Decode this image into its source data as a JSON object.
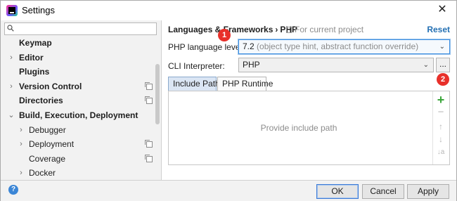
{
  "window": {
    "title": "Settings",
    "close_glyph": "✕"
  },
  "search": {
    "value": "",
    "placeholder": ""
  },
  "tree": [
    {
      "label": "Keymap",
      "bold": true,
      "level": 0,
      "expand": "",
      "copy": false
    },
    {
      "label": "Editor",
      "bold": true,
      "level": 0,
      "expand": "›",
      "copy": false
    },
    {
      "label": "Plugins",
      "bold": true,
      "level": 0,
      "expand": "",
      "copy": false
    },
    {
      "label": "Version Control",
      "bold": true,
      "level": 0,
      "expand": "›",
      "copy": true
    },
    {
      "label": "Directories",
      "bold": true,
      "level": 0,
      "expand": "",
      "copy": true
    },
    {
      "label": "Build, Execution, Deployment",
      "bold": true,
      "level": 0,
      "expand": "⌄",
      "copy": false
    },
    {
      "label": "Debugger",
      "bold": false,
      "level": 1,
      "expand": "›",
      "copy": false
    },
    {
      "label": "Deployment",
      "bold": false,
      "level": 1,
      "expand": "›",
      "copy": true
    },
    {
      "label": "Coverage",
      "bold": false,
      "level": 1,
      "expand": "",
      "copy": true
    },
    {
      "label": "Docker",
      "bold": false,
      "level": 1,
      "expand": "›",
      "copy": false
    }
  ],
  "header": {
    "crumb1": "Languages & Frameworks",
    "sep": "›",
    "crumb2": "PHP",
    "scope": "For current project",
    "reset": "Reset"
  },
  "form": {
    "language_level_label": "PHP language level:",
    "language_level_value": "7.2",
    "language_level_hint": "(object type hint, abstract function override)",
    "cli_label": "CLI Interpreter:",
    "cli_value": "PHP",
    "browse": "..."
  },
  "badges": {
    "first": "1",
    "second": "2"
  },
  "tabs": [
    {
      "label": "Include Path",
      "active": true
    },
    {
      "label": "PHP Runtime",
      "active": false
    }
  ],
  "include_path": {
    "placeholder": "Provide include path",
    "tools": {
      "add": "+",
      "remove": "−",
      "up": "↑",
      "down": "↓",
      "sort": "↓a"
    }
  },
  "buttons": {
    "help": "?",
    "ok": "OK",
    "cancel": "Cancel",
    "apply": "Apply"
  },
  "colors": {
    "accent": "#3d8ee0",
    "link": "#2470b3",
    "badge": "#e8302a",
    "add_green": "#3aa53a"
  }
}
